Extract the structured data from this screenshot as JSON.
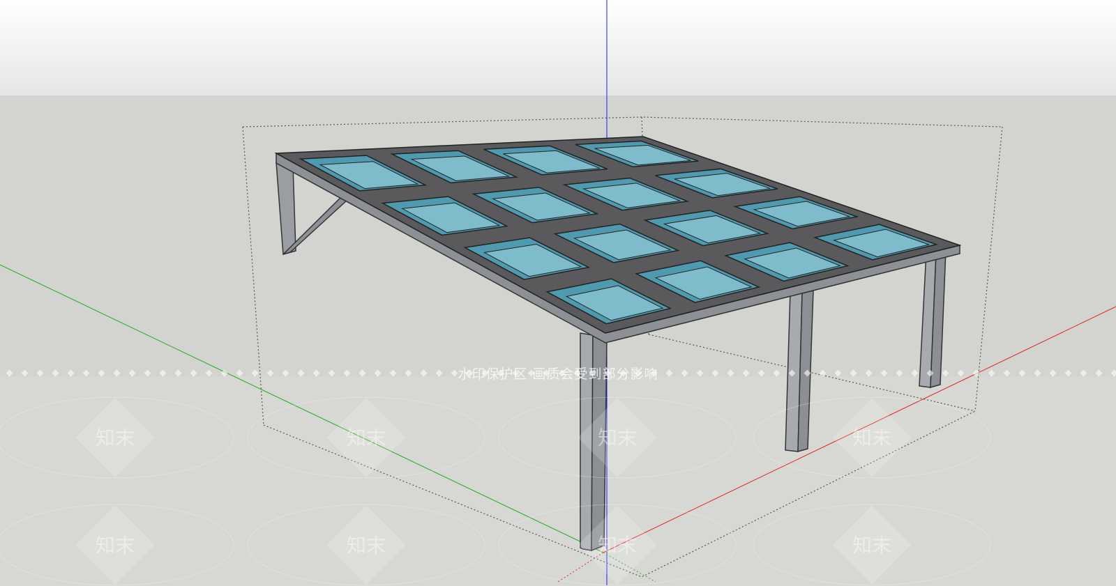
{
  "viewport": {
    "sky_color": "#ebebeb",
    "ground_color": "#d3d3cf",
    "axes": {
      "blue": "#1a1aff",
      "red": "#e02020",
      "green": "#22aa22"
    }
  },
  "model": {
    "glass_color": "#7fbccb",
    "frame_color": "#5a5a5c",
    "grid_cols": 4,
    "grid_rows": 4
  },
  "watermark": {
    "notice": "水印保护区  画质会受到部分影响",
    "mark_text": "知末"
  }
}
